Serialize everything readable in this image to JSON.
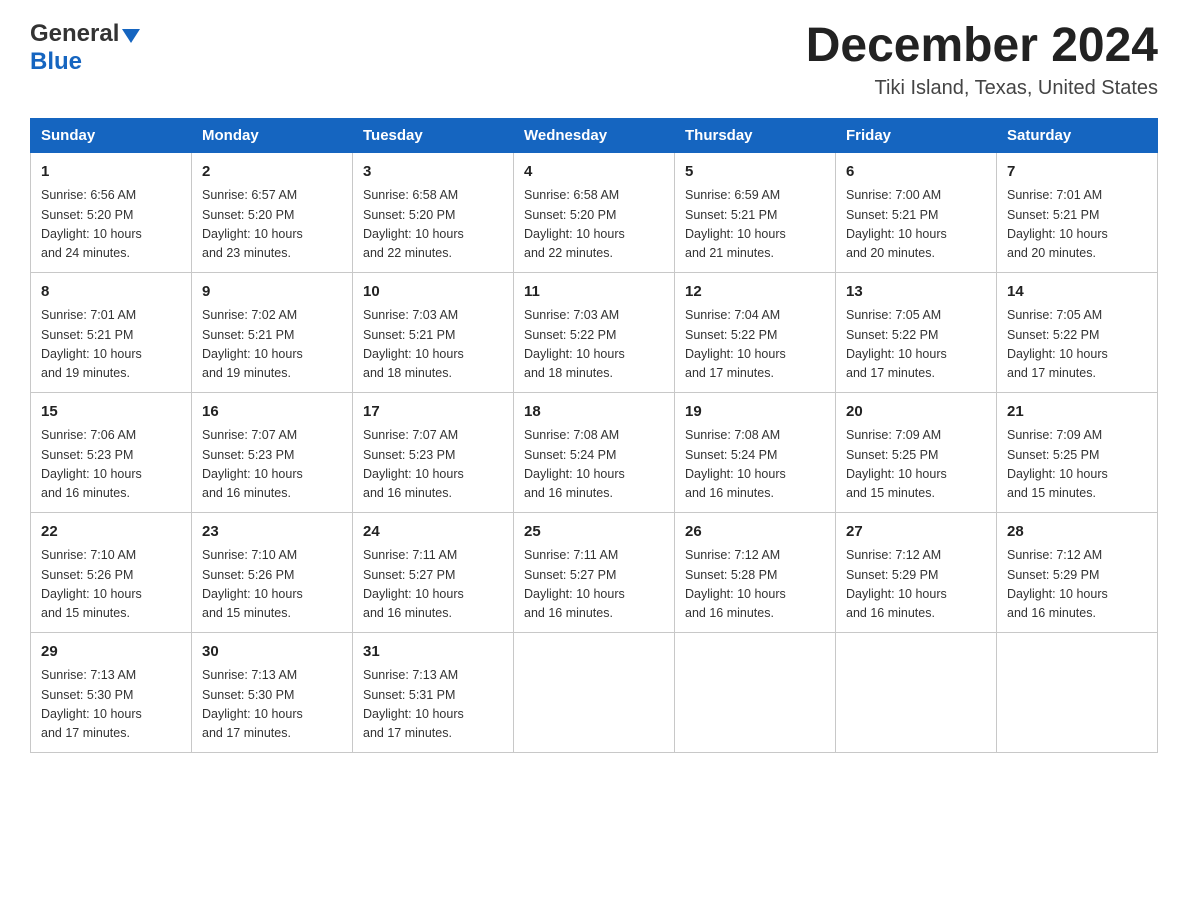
{
  "logo": {
    "general": "General",
    "blue": "Blue"
  },
  "title": "December 2024",
  "subtitle": "Tiki Island, Texas, United States",
  "days_of_week": [
    "Sunday",
    "Monday",
    "Tuesday",
    "Wednesday",
    "Thursday",
    "Friday",
    "Saturday"
  ],
  "weeks": [
    [
      {
        "num": "1",
        "info": "Sunrise: 6:56 AM\nSunset: 5:20 PM\nDaylight: 10 hours\nand 24 minutes."
      },
      {
        "num": "2",
        "info": "Sunrise: 6:57 AM\nSunset: 5:20 PM\nDaylight: 10 hours\nand 23 minutes."
      },
      {
        "num": "3",
        "info": "Sunrise: 6:58 AM\nSunset: 5:20 PM\nDaylight: 10 hours\nand 22 minutes."
      },
      {
        "num": "4",
        "info": "Sunrise: 6:58 AM\nSunset: 5:20 PM\nDaylight: 10 hours\nand 22 minutes."
      },
      {
        "num": "5",
        "info": "Sunrise: 6:59 AM\nSunset: 5:21 PM\nDaylight: 10 hours\nand 21 minutes."
      },
      {
        "num": "6",
        "info": "Sunrise: 7:00 AM\nSunset: 5:21 PM\nDaylight: 10 hours\nand 20 minutes."
      },
      {
        "num": "7",
        "info": "Sunrise: 7:01 AM\nSunset: 5:21 PM\nDaylight: 10 hours\nand 20 minutes."
      }
    ],
    [
      {
        "num": "8",
        "info": "Sunrise: 7:01 AM\nSunset: 5:21 PM\nDaylight: 10 hours\nand 19 minutes."
      },
      {
        "num": "9",
        "info": "Sunrise: 7:02 AM\nSunset: 5:21 PM\nDaylight: 10 hours\nand 19 minutes."
      },
      {
        "num": "10",
        "info": "Sunrise: 7:03 AM\nSunset: 5:21 PM\nDaylight: 10 hours\nand 18 minutes."
      },
      {
        "num": "11",
        "info": "Sunrise: 7:03 AM\nSunset: 5:22 PM\nDaylight: 10 hours\nand 18 minutes."
      },
      {
        "num": "12",
        "info": "Sunrise: 7:04 AM\nSunset: 5:22 PM\nDaylight: 10 hours\nand 17 minutes."
      },
      {
        "num": "13",
        "info": "Sunrise: 7:05 AM\nSunset: 5:22 PM\nDaylight: 10 hours\nand 17 minutes."
      },
      {
        "num": "14",
        "info": "Sunrise: 7:05 AM\nSunset: 5:22 PM\nDaylight: 10 hours\nand 17 minutes."
      }
    ],
    [
      {
        "num": "15",
        "info": "Sunrise: 7:06 AM\nSunset: 5:23 PM\nDaylight: 10 hours\nand 16 minutes."
      },
      {
        "num": "16",
        "info": "Sunrise: 7:07 AM\nSunset: 5:23 PM\nDaylight: 10 hours\nand 16 minutes."
      },
      {
        "num": "17",
        "info": "Sunrise: 7:07 AM\nSunset: 5:23 PM\nDaylight: 10 hours\nand 16 minutes."
      },
      {
        "num": "18",
        "info": "Sunrise: 7:08 AM\nSunset: 5:24 PM\nDaylight: 10 hours\nand 16 minutes."
      },
      {
        "num": "19",
        "info": "Sunrise: 7:08 AM\nSunset: 5:24 PM\nDaylight: 10 hours\nand 16 minutes."
      },
      {
        "num": "20",
        "info": "Sunrise: 7:09 AM\nSunset: 5:25 PM\nDaylight: 10 hours\nand 15 minutes."
      },
      {
        "num": "21",
        "info": "Sunrise: 7:09 AM\nSunset: 5:25 PM\nDaylight: 10 hours\nand 15 minutes."
      }
    ],
    [
      {
        "num": "22",
        "info": "Sunrise: 7:10 AM\nSunset: 5:26 PM\nDaylight: 10 hours\nand 15 minutes."
      },
      {
        "num": "23",
        "info": "Sunrise: 7:10 AM\nSunset: 5:26 PM\nDaylight: 10 hours\nand 15 minutes."
      },
      {
        "num": "24",
        "info": "Sunrise: 7:11 AM\nSunset: 5:27 PM\nDaylight: 10 hours\nand 16 minutes."
      },
      {
        "num": "25",
        "info": "Sunrise: 7:11 AM\nSunset: 5:27 PM\nDaylight: 10 hours\nand 16 minutes."
      },
      {
        "num": "26",
        "info": "Sunrise: 7:12 AM\nSunset: 5:28 PM\nDaylight: 10 hours\nand 16 minutes."
      },
      {
        "num": "27",
        "info": "Sunrise: 7:12 AM\nSunset: 5:29 PM\nDaylight: 10 hours\nand 16 minutes."
      },
      {
        "num": "28",
        "info": "Sunrise: 7:12 AM\nSunset: 5:29 PM\nDaylight: 10 hours\nand 16 minutes."
      }
    ],
    [
      {
        "num": "29",
        "info": "Sunrise: 7:13 AM\nSunset: 5:30 PM\nDaylight: 10 hours\nand 17 minutes."
      },
      {
        "num": "30",
        "info": "Sunrise: 7:13 AM\nSunset: 5:30 PM\nDaylight: 10 hours\nand 17 minutes."
      },
      {
        "num": "31",
        "info": "Sunrise: 7:13 AM\nSunset: 5:31 PM\nDaylight: 10 hours\nand 17 minutes."
      },
      null,
      null,
      null,
      null
    ]
  ]
}
